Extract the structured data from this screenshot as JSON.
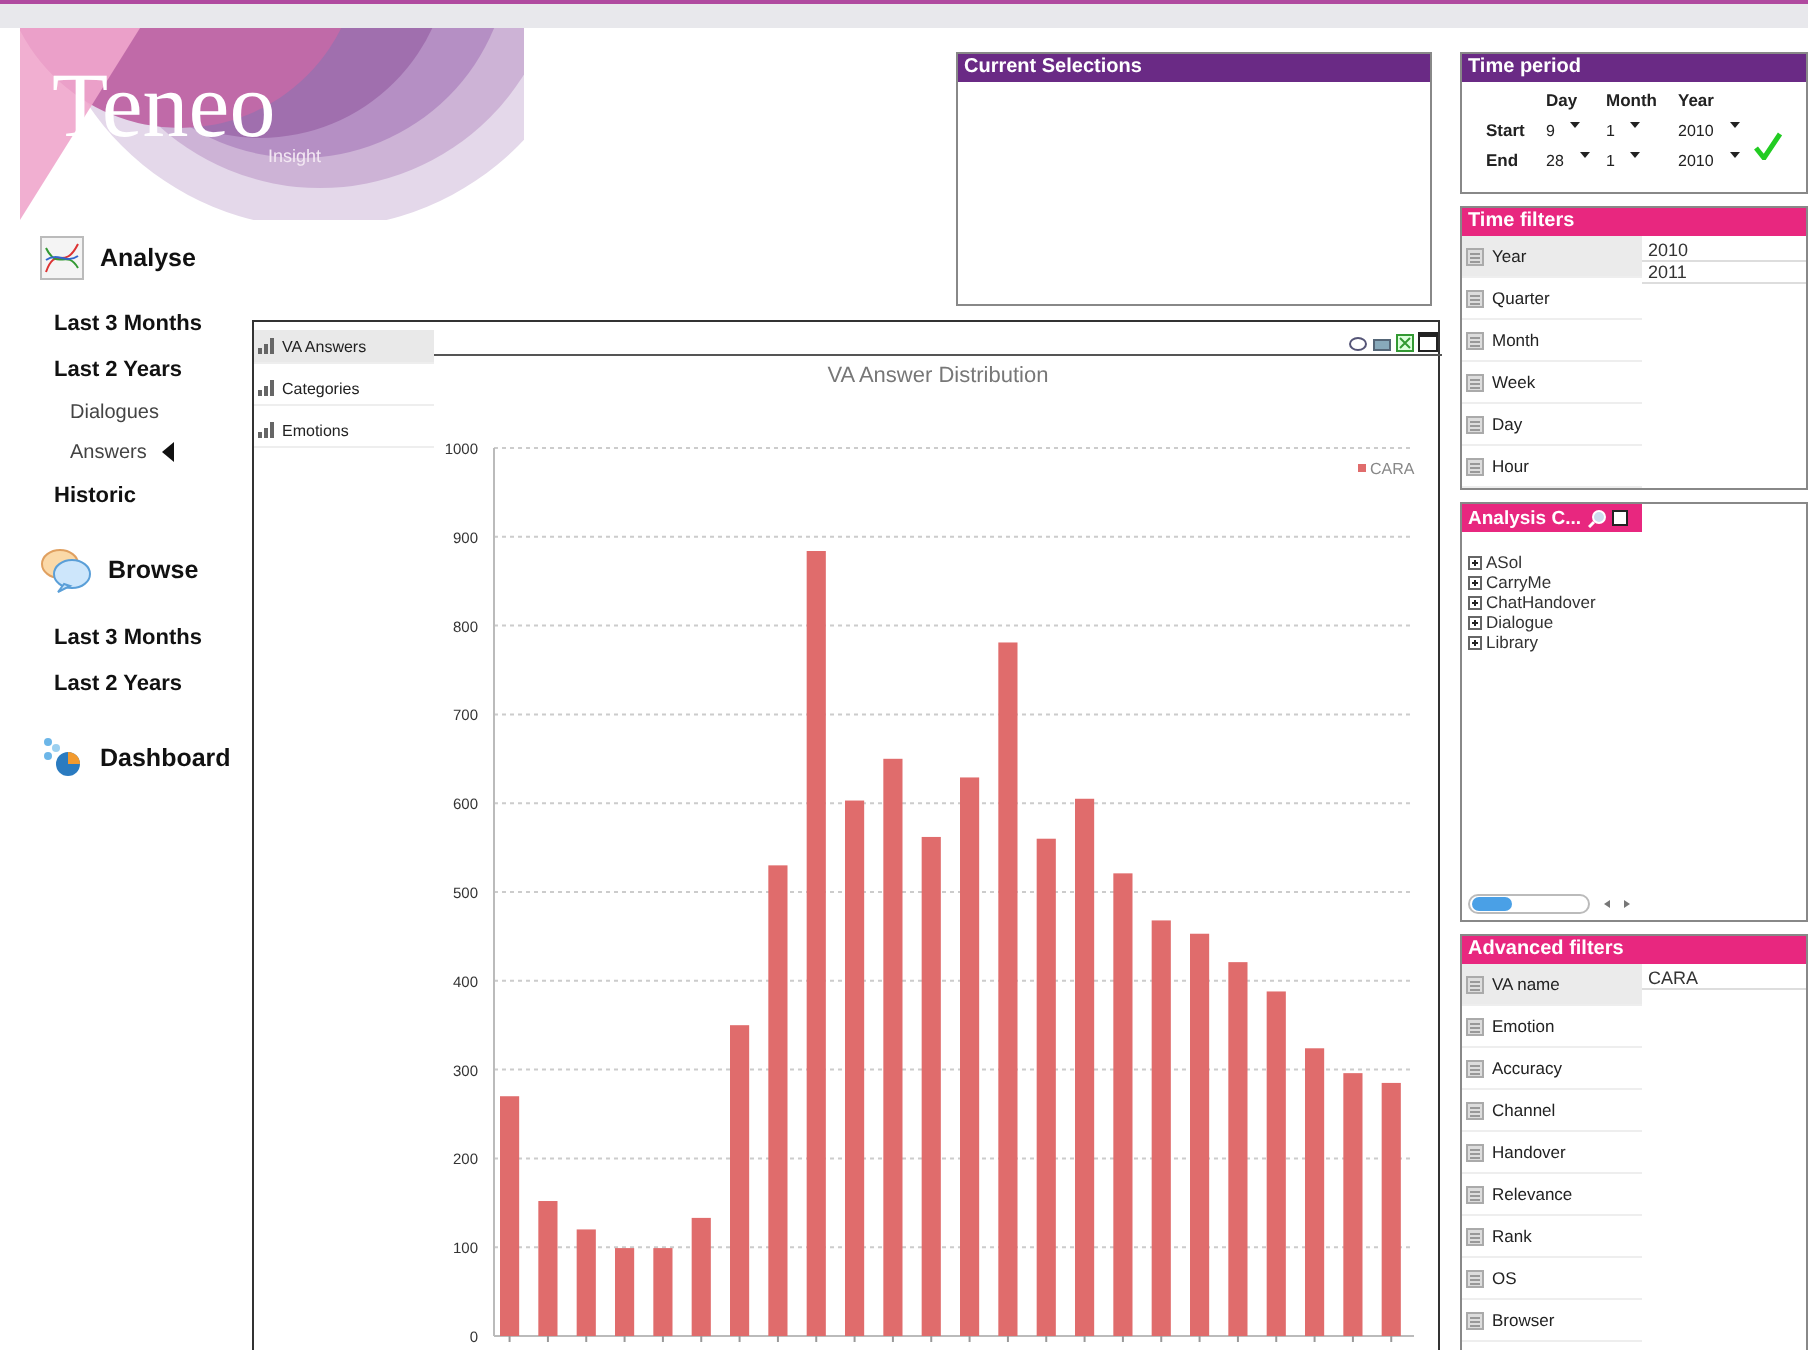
{
  "logo": {
    "name": "Teneo",
    "tagline": "Insight"
  },
  "nav": [
    {
      "title": "Analyse",
      "items": [
        {
          "label": "Last 3 Months",
          "selected": false
        },
        {
          "label": "Last 2 Years",
          "selected": false,
          "children": [
            {
              "label": "Dialogues",
              "selected": false
            },
            {
              "label": "Answers",
              "selected": true
            }
          ]
        },
        {
          "label": "Historic",
          "selected": false
        }
      ]
    },
    {
      "title": "Browse",
      "items": [
        {
          "label": "Last 3 Months",
          "selected": false
        },
        {
          "label": "Last 2 Years",
          "selected": false
        }
      ]
    },
    {
      "title": "Dashboard"
    }
  ],
  "current_selections": {
    "title": "Current Selections"
  },
  "chart_panel": {
    "tabs": [
      {
        "label": "VA Answers",
        "selected": true
      },
      {
        "label": "Categories",
        "selected": false
      },
      {
        "label": "Emotions",
        "selected": false
      }
    ],
    "chart_data": {
      "type": "bar",
      "title": "VA Answer Distribution",
      "grid": true,
      "series": [
        {
          "name": "CARA",
          "color": "#e06c6c",
          "values": [
            270,
            152,
            120,
            99,
            99,
            133,
            350,
            530,
            884,
            603,
            650,
            562,
            629,
            781,
            560,
            605,
            521,
            468,
            453,
            421,
            388,
            324,
            296,
            285
          ]
        }
      ],
      "ylim": [
        0,
        1000
      ],
      "yticks": [
        0,
        100,
        200,
        300,
        400,
        500,
        600,
        700,
        800,
        900,
        1000
      ]
    }
  },
  "time_period": {
    "title": "Time period",
    "columns": [
      "Day",
      "Month",
      "Year"
    ],
    "rows": [
      {
        "label": "Start",
        "values": [
          "9",
          "1",
          "2010"
        ]
      },
      {
        "label": "End",
        "values": [
          "28",
          "1",
          "2010"
        ]
      }
    ]
  },
  "time_filters": {
    "title": "Time filters",
    "items": [
      {
        "label": "Year",
        "selected": true
      },
      {
        "label": "Quarter",
        "selected": false
      },
      {
        "label": "Month",
        "selected": false
      },
      {
        "label": "Week",
        "selected": false
      },
      {
        "label": "Day",
        "selected": false
      },
      {
        "label": "Hour",
        "selected": false
      }
    ],
    "values": [
      "2010",
      "2011"
    ]
  },
  "analysis": {
    "title": "Analysis C...",
    "tree": [
      {
        "label": "ASol",
        "expanded": false
      },
      {
        "label": "CarryMe",
        "expanded": false
      },
      {
        "label": "ChatHandover",
        "expanded": false
      },
      {
        "label": "Dialogue",
        "expanded": false
      },
      {
        "label": "Library",
        "expanded": false
      }
    ]
  },
  "advanced_filters": {
    "title": "Advanced filters",
    "items": [
      {
        "label": "VA name",
        "selected": true
      },
      {
        "label": "Emotion",
        "selected": false
      },
      {
        "label": "Accuracy",
        "selected": false
      },
      {
        "label": "Channel",
        "selected": false
      },
      {
        "label": "Handover",
        "selected": false
      },
      {
        "label": "Relevance",
        "selected": false
      },
      {
        "label": "Rank",
        "selected": false
      },
      {
        "label": "OS",
        "selected": false
      },
      {
        "label": "Browser",
        "selected": false
      }
    ],
    "values": [
      "CARA"
    ]
  }
}
